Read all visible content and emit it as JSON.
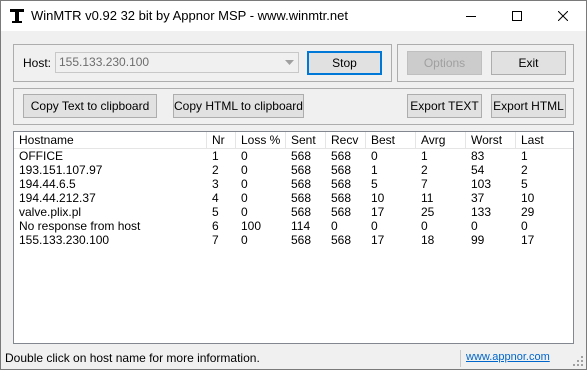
{
  "window": {
    "title": "WinMTR v0.92 32 bit by Appnor MSP - www.winmtr.net"
  },
  "host": {
    "label": "Host:",
    "value": "155.133.230.100"
  },
  "buttons": {
    "stop": "Stop",
    "options": "Options",
    "exit": "Exit",
    "copy_text": "Copy Text to clipboard",
    "copy_html": "Copy HTML to clipboard",
    "export_text": "Export TEXT",
    "export_html": "Export HTML"
  },
  "table": {
    "columns": [
      "Hostname",
      "Nr",
      "Loss %",
      "Sent",
      "Recv",
      "Best",
      "Avrg",
      "Worst",
      "Last"
    ],
    "rows": [
      [
        "OFFICE",
        "1",
        "0",
        "568",
        "568",
        "0",
        "1",
        "83",
        "1"
      ],
      [
        "193.151.107.97",
        "2",
        "0",
        "568",
        "568",
        "1",
        "2",
        "54",
        "2"
      ],
      [
        "194.44.6.5",
        "3",
        "0",
        "568",
        "568",
        "5",
        "7",
        "103",
        "5"
      ],
      [
        "194.44.212.37",
        "4",
        "0",
        "568",
        "568",
        "10",
        "11",
        "37",
        "10"
      ],
      [
        "valve.plix.pl",
        "5",
        "0",
        "568",
        "568",
        "17",
        "25",
        "133",
        "29"
      ],
      [
        "No response from host",
        "6",
        "100",
        "114",
        "0",
        "0",
        "0",
        "0",
        "0"
      ],
      [
        "155.133.230.100",
        "7",
        "0",
        "568",
        "568",
        "17",
        "18",
        "99",
        "17"
      ]
    ]
  },
  "status": {
    "message": "Double click on host name for more information.",
    "link": "www.appnor.com"
  }
}
